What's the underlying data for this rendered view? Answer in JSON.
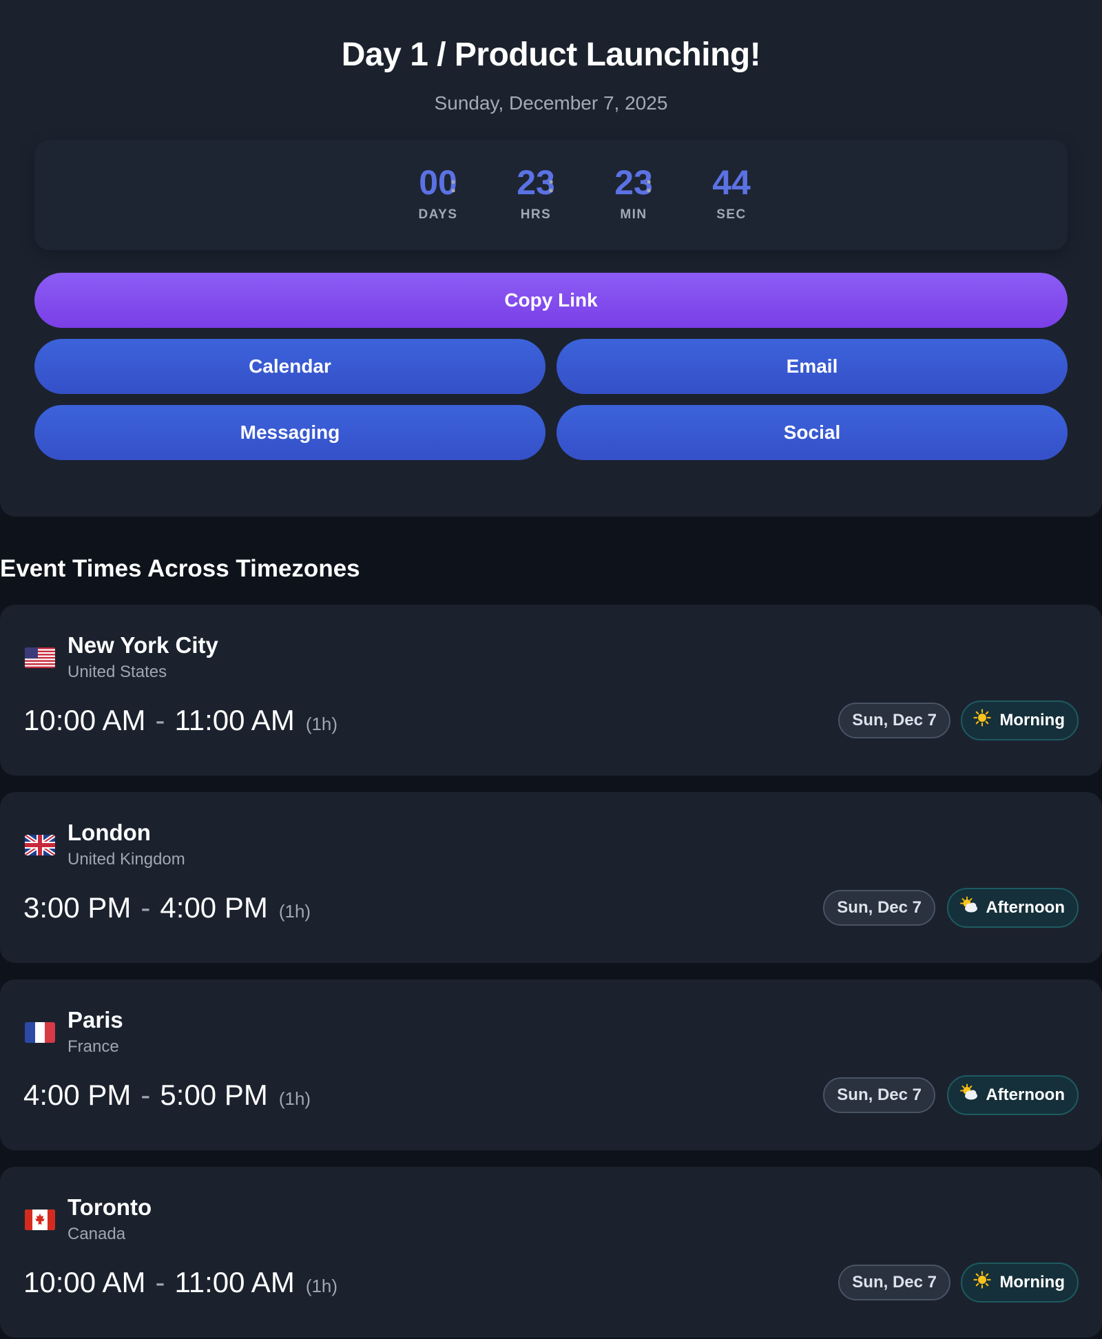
{
  "header": {
    "title": "Day 1 / Product Launching!",
    "date": "Sunday, December 7, 2025"
  },
  "countdown": {
    "units": [
      {
        "value": "00",
        "label": "DAYS"
      },
      {
        "value": "23",
        "label": "HRS"
      },
      {
        "value": "23",
        "label": "MIN"
      },
      {
        "value": "44",
        "label": "SEC"
      }
    ],
    "separator": ":"
  },
  "actions": {
    "copy_link": "Copy Link",
    "calendar": "Calendar",
    "email": "Email",
    "messaging": "Messaging",
    "social": "Social"
  },
  "timezones": {
    "section_title": "Event Times Across Timezones",
    "items": [
      {
        "flag": "us-flag",
        "city": "New York City",
        "country": "United States",
        "start": "10:00 AM",
        "end": "11:00 AM",
        "duration": "(1h)",
        "date": "Sun, Dec 7",
        "period": "Morning",
        "period_icon": "sun-icon"
      },
      {
        "flag": "uk-flag",
        "city": "London",
        "country": "United Kingdom",
        "start": "3:00 PM",
        "end": "4:00 PM",
        "duration": "(1h)",
        "date": "Sun, Dec 7",
        "period": "Afternoon",
        "period_icon": "sun-cloud-icon"
      },
      {
        "flag": "fr-flag",
        "city": "Paris",
        "country": "France",
        "start": "4:00 PM",
        "end": "5:00 PM",
        "duration": "(1h)",
        "date": "Sun, Dec 7",
        "period": "Afternoon",
        "period_icon": "sun-cloud-icon"
      },
      {
        "flag": "ca-flag",
        "city": "Toronto",
        "country": "Canada",
        "start": "10:00 AM",
        "end": "11:00 AM",
        "duration": "(1h)",
        "date": "Sun, Dec 7",
        "period": "Morning",
        "period_icon": "sun-icon"
      }
    ]
  },
  "colors": {
    "accent": "#5b72e4",
    "primary_button": "#8557f2",
    "secondary_button": "#3a5bd6",
    "card": "#1b222e",
    "background": "#0e131b"
  }
}
